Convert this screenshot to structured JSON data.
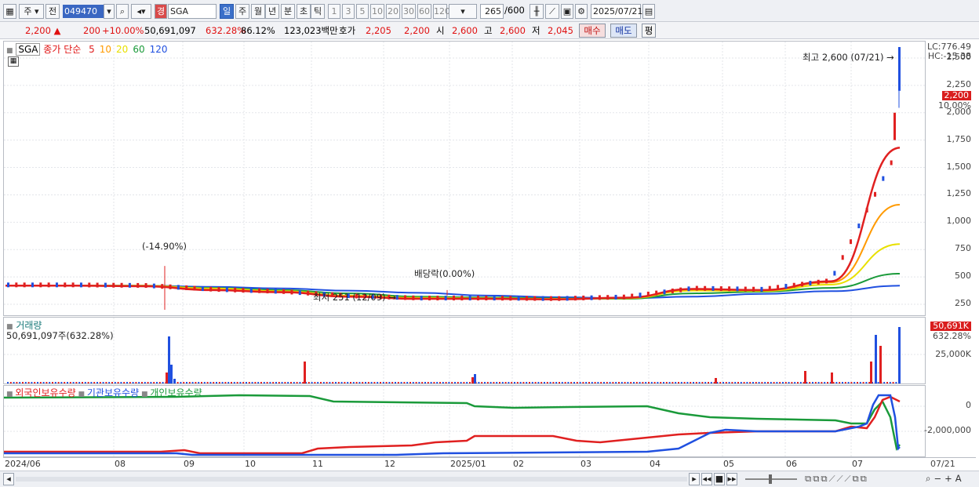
{
  "toolbar": {
    "period_type": "주",
    "prev_label": "전",
    "stock_code": "049470",
    "search_name": "SGA",
    "exchange_badge": "경",
    "tabs": [
      "일",
      "주",
      "월",
      "년",
      "분",
      "초",
      "틱"
    ],
    "active_tab": "일",
    "intervals": [
      "1",
      "3",
      "5",
      "10",
      "20",
      "30",
      "60",
      "120"
    ],
    "count": "265",
    "count_max": "/600",
    "date": "2025/07/21"
  },
  "quote": {
    "price": "2,200",
    "change": "200",
    "change_pct": "+10.00%",
    "volume": "50,691,097",
    "volume_ratio": "632.28%",
    "turnover": "86.12%",
    "amount": "123,023백만",
    "hoga_label": "호가",
    "hoga_bid": "2,205",
    "hoga_ask": "2,200",
    "open_label": "시",
    "open": "2,600",
    "high_label": "고",
    "high": "2,600",
    "low_label": "저",
    "low": "2,045",
    "buy_label": "매수",
    "sell_label": "매도",
    "avg_label": "평"
  },
  "price_panel": {
    "symbol": "SGA",
    "ma_label": "종가 단순",
    "ma_periods": [
      "5",
      "10",
      "20",
      "60",
      "120"
    ],
    "ma_colors": [
      "#e02020",
      "#ff9a00",
      "#e8e000",
      "#1a9a3a",
      "#2050e0"
    ],
    "lc": "LC:776.49",
    "hc": "HC:-15.38",
    "current_tag": "2,200",
    "current_pct": "10.00%",
    "high_note": "최고 2,600 (07/21)",
    "low_note": "최저 251 (12/09)",
    "ann_split": "(-14.90%)",
    "ann_dividend": "배당락(0.00%)"
  },
  "volume_panel": {
    "title": "거래량",
    "value_text": "50,691,097주(632.28%)",
    "tag": "50,691K",
    "tag_pct": "632.28%",
    "axis_label": "25,000K"
  },
  "holding_panel": {
    "legend": [
      "외국인보유수량",
      "기관보유수량",
      "개인보유수량"
    ],
    "legend_colors": [
      "#e02020",
      "#2050e0",
      "#1a9a3a"
    ],
    "axis_labels": [
      "0",
      "-2,000,000"
    ]
  },
  "x_axis": {
    "labels": [
      "2024/06",
      "08",
      "09",
      "10",
      "11",
      "12",
      "2025/01",
      "02",
      "03",
      "04",
      "05",
      "06",
      "07"
    ],
    "right_label": "07/21"
  },
  "chart_data": {
    "type": "line",
    "title": "SGA",
    "y_ticks": [
      250,
      500,
      750,
      1000,
      1250,
      1500,
      1750,
      2000,
      2250,
      2500
    ],
    "ylim": [
      150,
      2650
    ],
    "x_labels": [
      "2024/06",
      "08",
      "09",
      "10",
      "11",
      "12",
      "2025/01",
      "02",
      "03",
      "04",
      "05",
      "06",
      "07",
      "07/21"
    ],
    "series": [
      {
        "name": "5",
        "values": [
          420,
          420,
          415,
          380,
          360,
          320,
          300,
          300,
          295,
          310,
          390,
          380,
          460,
          1680
        ]
      },
      {
        "name": "10",
        "values": [
          420,
          420,
          418,
          385,
          365,
          325,
          305,
          302,
          298,
          308,
          385,
          378,
          450,
          1160
        ]
      },
      {
        "name": "20",
        "values": [
          420,
          420,
          420,
          395,
          370,
          330,
          310,
          305,
          300,
          305,
          375,
          372,
          430,
          800
        ]
      },
      {
        "name": "60",
        "values": [
          420,
          420,
          420,
          400,
          380,
          350,
          320,
          312,
          305,
          300,
          350,
          365,
          400,
          530
        ]
      },
      {
        "name": "120",
        "values": [
          420,
          420,
          420,
          410,
          395,
          375,
          355,
          330,
          315,
          305,
          320,
          345,
          370,
          420
        ]
      }
    ],
    "high": 2600,
    "low": 251,
    "last": 2200
  }
}
